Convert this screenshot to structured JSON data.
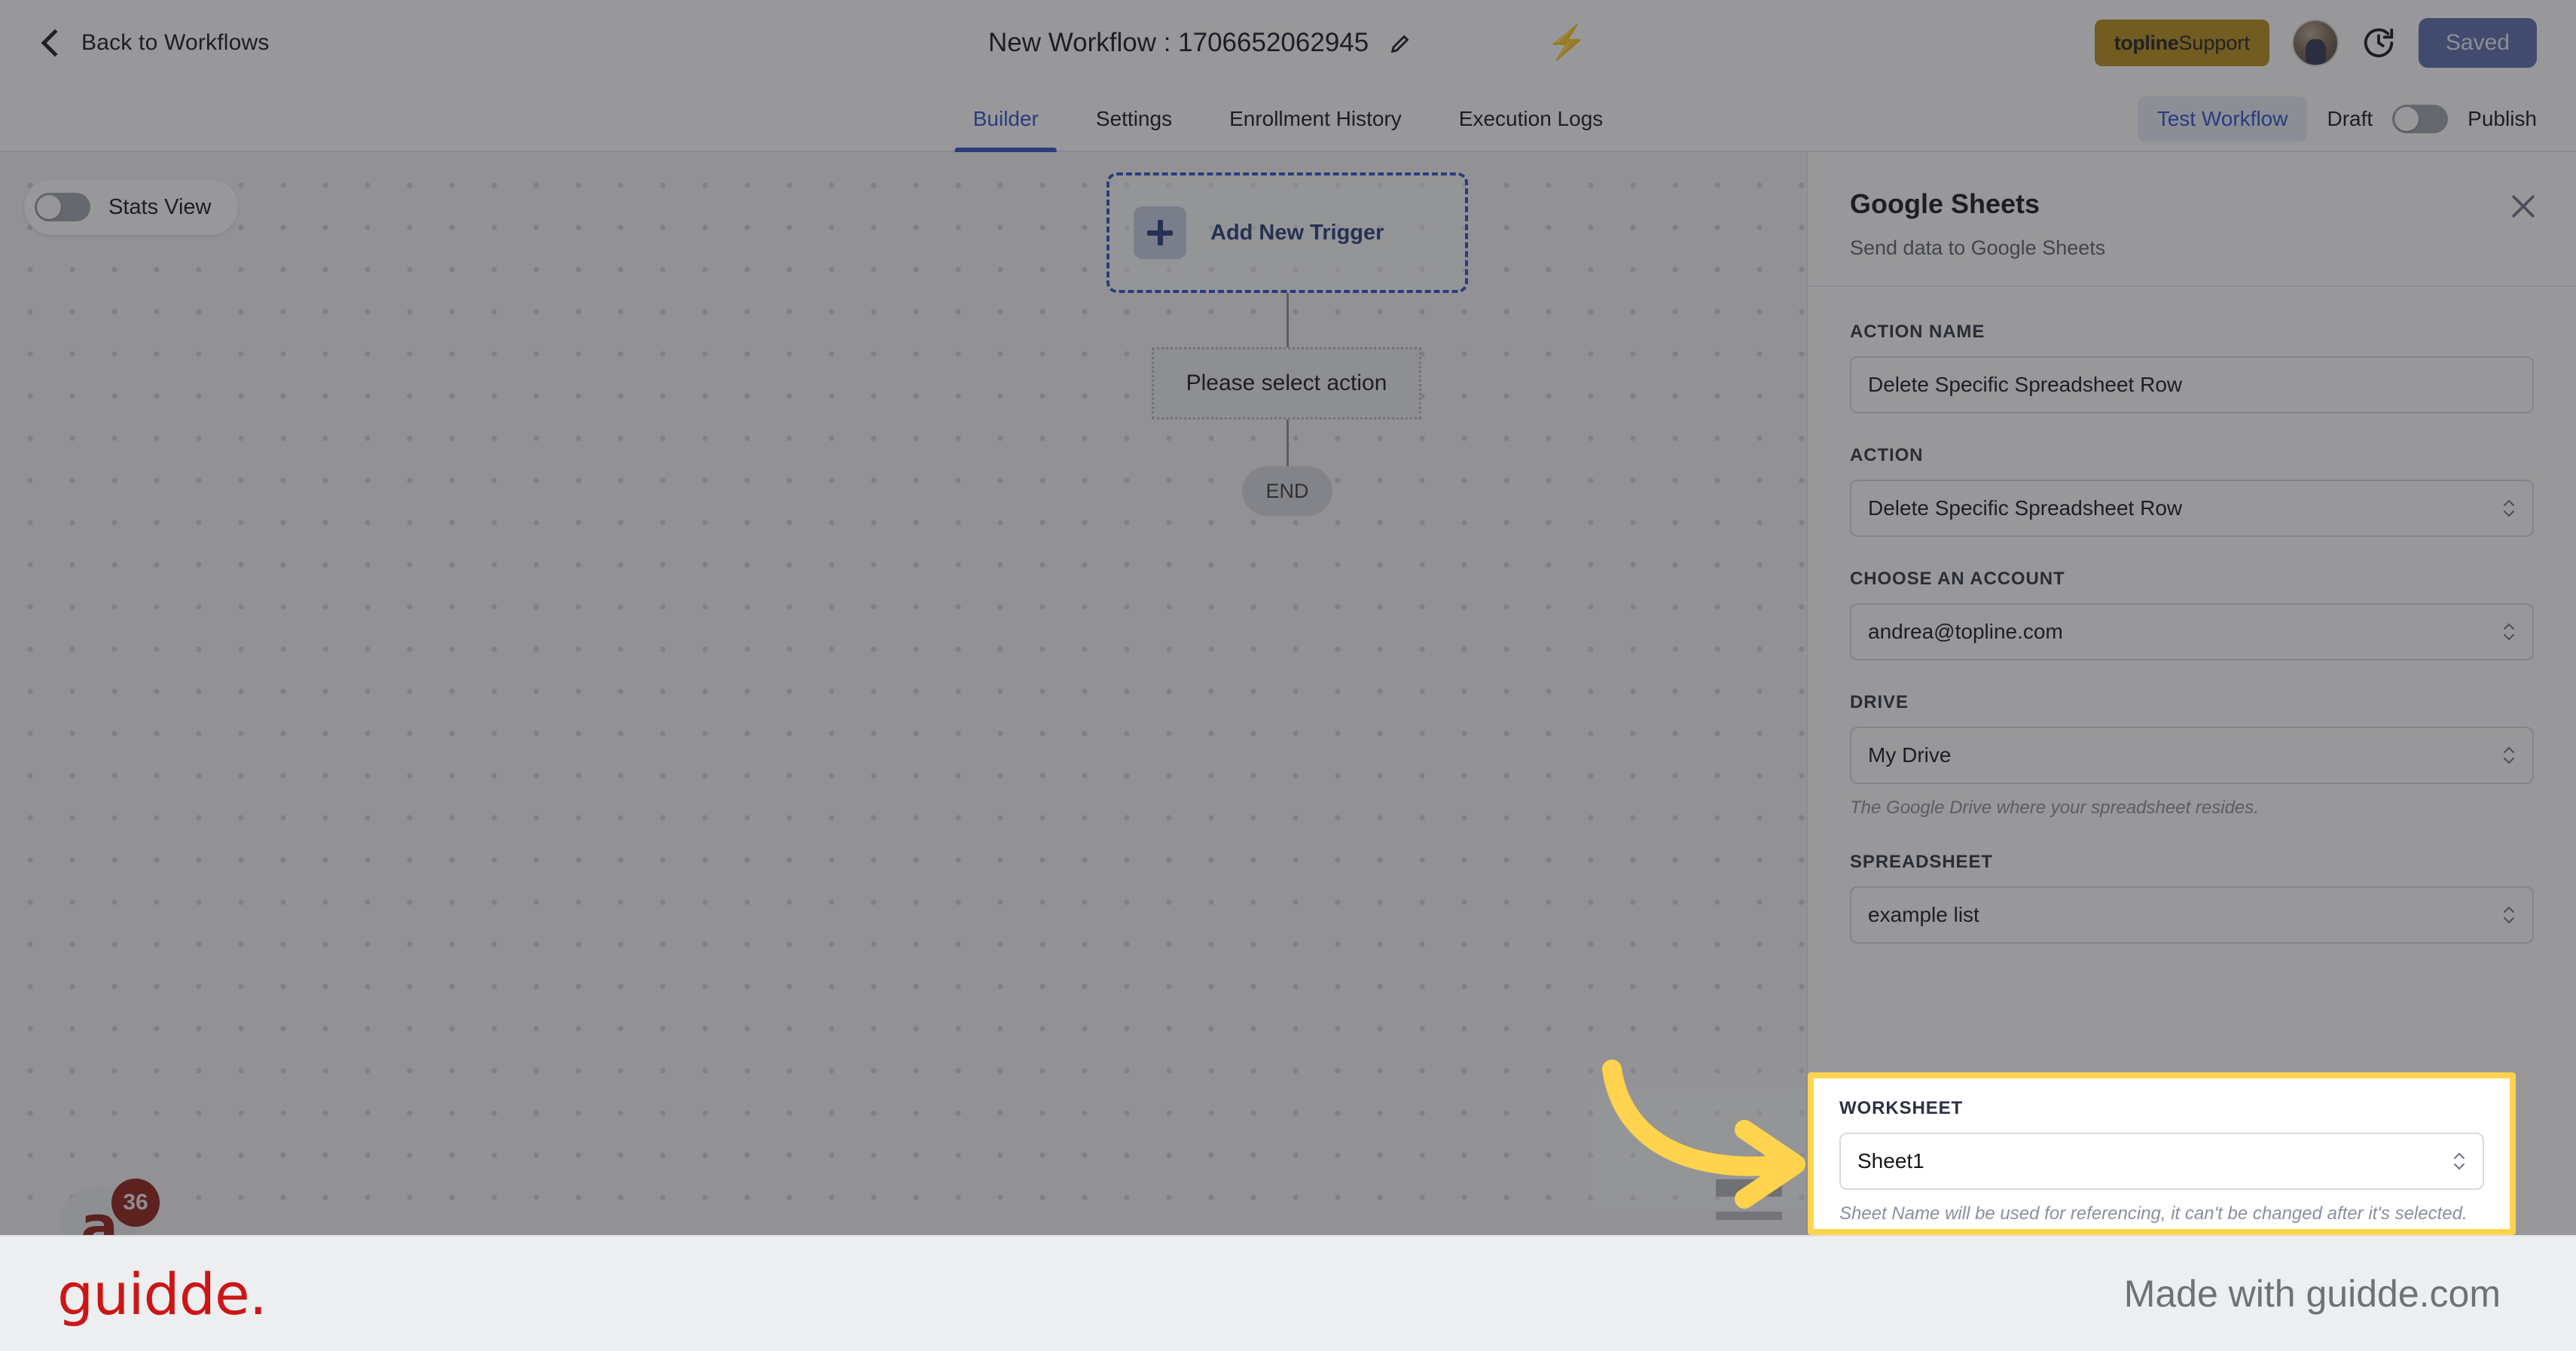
{
  "topbar": {
    "back_label": "Back to Workflows",
    "workflow_title": "New Workflow : 1706652062945",
    "edit_icon": "pencil-icon",
    "bolt_icon": "lightning-bolt-icon",
    "support_brand": "topline",
    "support_suffix": " Support",
    "history_icon": "clock-history-icon",
    "saved_label": "Saved",
    "accent_gold": "#b78c17",
    "accent_blue": "#5b6cab"
  },
  "tabbar": {
    "tabs": [
      {
        "label": "Builder",
        "active": true
      },
      {
        "label": "Settings",
        "active": false
      },
      {
        "label": "Enrollment History",
        "active": false
      },
      {
        "label": "Execution Logs",
        "active": false
      }
    ],
    "test_workflow_label": "Test Workflow",
    "draft_label": "Draft",
    "publish_label": "Publish",
    "toggle_state": "off",
    "active_color": "#2d50c8"
  },
  "canvas": {
    "stats_view_label": "Stats View",
    "stats_view_state": "off",
    "trigger_label": "Add New Trigger",
    "trigger_icon": "plus-icon",
    "action_placeholder": "Please select action",
    "end_label": "END",
    "chat_glyph": "a",
    "chat_badge_count": "36"
  },
  "panel": {
    "title": "Google Sheets",
    "subtitle": "Send data to Google Sheets",
    "close_icon": "close-icon",
    "fields": [
      {
        "label": "ACTION NAME",
        "value": "Delete Specific Spreadsheet Row",
        "type": "text",
        "help": ""
      },
      {
        "label": "ACTION",
        "value": "Delete Specific Spreadsheet Row",
        "type": "select",
        "help": ""
      },
      {
        "label": "CHOOSE AN ACCOUNT",
        "value": "andrea@topline.com",
        "type": "select",
        "help": ""
      },
      {
        "label": "DRIVE",
        "value": "My Drive",
        "type": "select",
        "help": "The Google Drive where your spreadsheet resides."
      },
      {
        "label": "SPREADSHEET",
        "value": "example list",
        "type": "select",
        "help": ""
      }
    ],
    "worksheet": {
      "label": "WORKSHEET",
      "value": "Sheet1",
      "help": "Sheet Name will be used for referencing, it can't be changed after it's selected.",
      "highlight_color": "#ffd34d"
    }
  },
  "annotation": {
    "arrow_icon": "curved-arrow-right-icon",
    "arrow_color": "#ffd34d"
  },
  "footer": {
    "logo_text": "guidde.",
    "made_with": "Made with guidde.com",
    "logo_color": "#cc1616"
  }
}
